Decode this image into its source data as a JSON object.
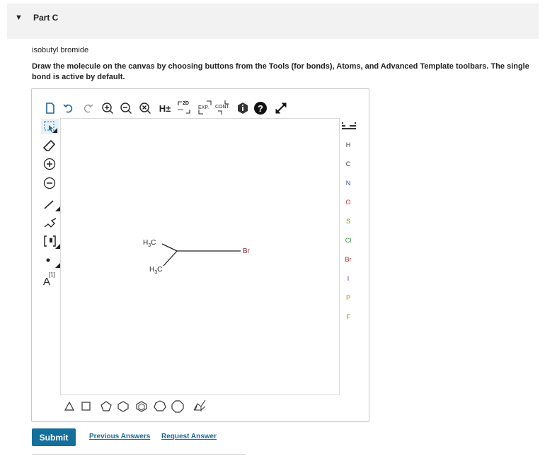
{
  "part": {
    "title": "Part C"
  },
  "question": {
    "title": "isobutyl bromide",
    "instructions": "Draw the molecule on the canvas by choosing buttons from the Tools (for bonds), Atoms, and Advanced Template toolbars. The single bond is active by default."
  },
  "toolbar": {
    "h_toggle": "H±",
    "two_d": "2D",
    "exp": "EXP.",
    "cont": "CONT."
  },
  "left_toolbar": {
    "charge_label": "A",
    "charge_sup": "[1]"
  },
  "atoms": [
    "H",
    "C",
    "N",
    "O",
    "S",
    "Cl",
    "Br",
    "I",
    "P",
    "F"
  ],
  "atom_colors": {
    "H": "#333333",
    "C": "#333333",
    "N": "#2a3fbf",
    "O": "#c0392b",
    "S": "#8c8c00",
    "Cl": "#2e8b2e",
    "Br": "#8b2b2b",
    "I": "#6b2b8b",
    "P": "#d07a00",
    "F": "#6a9a3a"
  },
  "molecule": {
    "label_ch3_top": "H3C",
    "label_ch3_bottom": "H3C",
    "label_br": "Br"
  },
  "actions": {
    "submit": "Submit",
    "previous_answers": "Previous Answers",
    "request_answer": "Request Answer"
  }
}
